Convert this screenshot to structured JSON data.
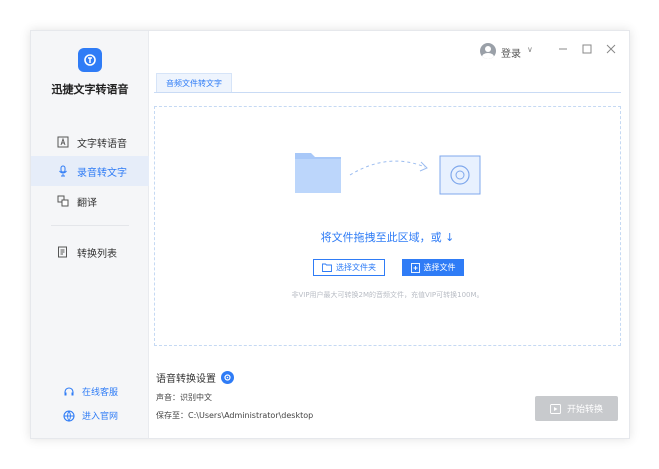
{
  "app": {
    "name": "迅捷文字转语音"
  },
  "nav": {
    "items": [
      {
        "label": "文字转语音",
        "icon": "text-to-speech-icon"
      },
      {
        "label": "录音转文字",
        "icon": "microphone-icon",
        "active": true
      },
      {
        "label": "翻译",
        "icon": "translate-icon"
      },
      {
        "label": "转换列表",
        "icon": "list-icon"
      }
    ]
  },
  "footer": {
    "service": "在线客服",
    "website": "进入官网"
  },
  "titlebar": {
    "login": "登录",
    "chevron": "∨"
  },
  "tabs": [
    {
      "label": "音频文件转文字"
    }
  ],
  "dropzone": {
    "text": "将文件拖拽至此区域，或  ↓",
    "folder_button": "选择文件夹",
    "file_button": "选择文件",
    "tip": "非VIP用户最大可转换2M的音频文件，充值VIP可转换100M。"
  },
  "settings": {
    "title": "语音转换设置",
    "voice": "声音：识别中文",
    "save_path": "保存至：C:\\Users\\Administrator\\desktop"
  },
  "start_button": "开始转换",
  "colors": {
    "accent": "#2f7cf6",
    "disabled": "#c8cacd"
  }
}
